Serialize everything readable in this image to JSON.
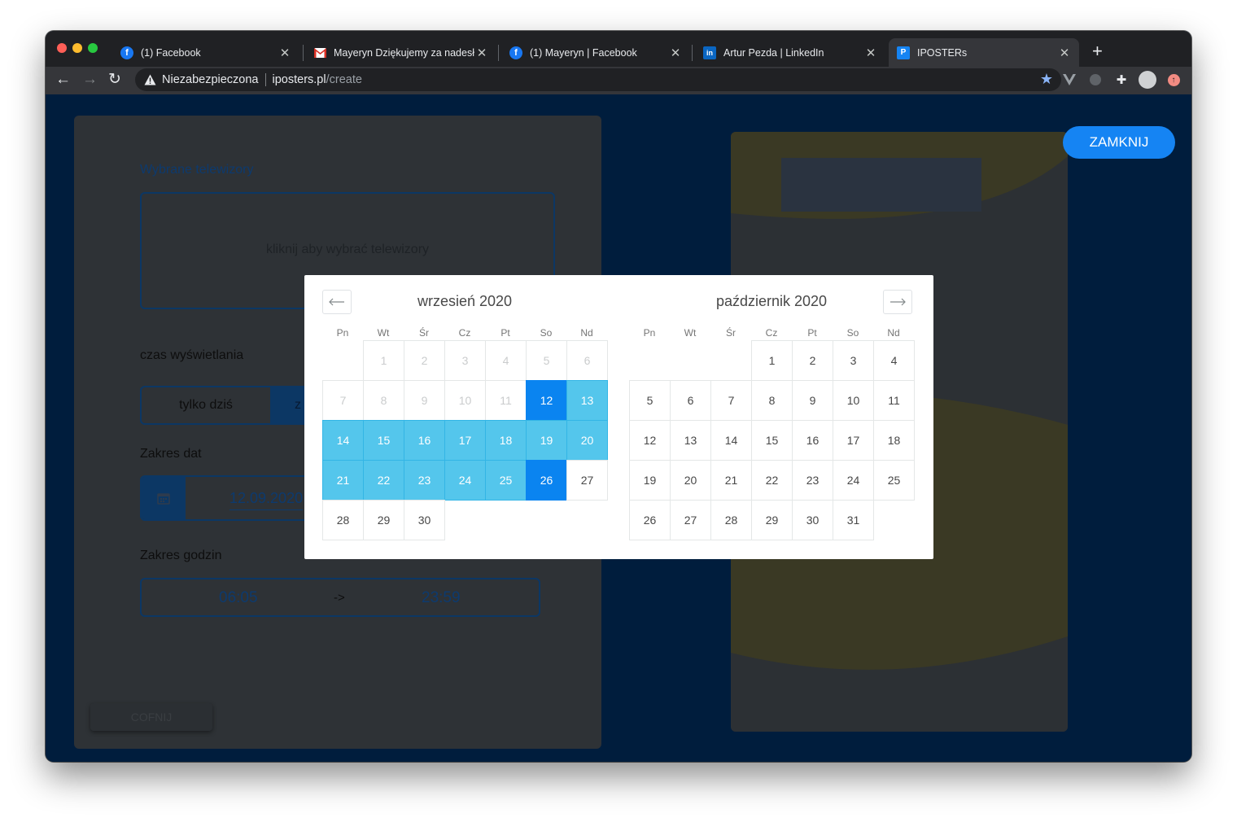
{
  "browser": {
    "tabs": [
      {
        "title": "(1) Facebook",
        "icon": "facebook-icon",
        "active": false
      },
      {
        "title": "Mayeryn Dziękujemy za nadesł",
        "icon": "gmail-icon",
        "active": false
      },
      {
        "title": "(1) Mayeryn | Facebook",
        "icon": "facebook-icon",
        "active": false
      },
      {
        "title": "Artur Pezda | LinkedIn",
        "icon": "linkedin-icon",
        "active": false
      },
      {
        "title": "IPOSTERs",
        "icon": "iposters-icon",
        "active": true
      }
    ],
    "security_label": "Niezabezpieczona",
    "url_host": "iposters.pl",
    "url_path": "/create",
    "colors": {
      "accent": "#1584f3",
      "page_bg": "#001d3d",
      "range": "#54c6ec",
      "selected": "#0a84f0"
    }
  },
  "form": {
    "tv_label": "Wybrane telewizory",
    "tv_placeholder": "kliknij aby wybrać telewizory",
    "display_time_label": "czas wyświetlania",
    "option_today": "tylko dziś",
    "option_other": "z",
    "date_range_label": "Zakres dat",
    "date_start": "12.09.2020",
    "time_range_label": "Zakres godzin",
    "time_start": "06:05",
    "time_arrow": "->",
    "time_end": "23:59",
    "back_button": "COFNIJ"
  },
  "close_button": "ZAMKNIJ",
  "calendar": {
    "weekdays": [
      "Pn",
      "Wt",
      "Śr",
      "Cz",
      "Pt",
      "So",
      "Nd"
    ],
    "months": [
      {
        "title": "wrzesień 2020",
        "offset": 1,
        "days": 30,
        "blocked_until": 11,
        "selected_start": 12,
        "selected_end": 26
      },
      {
        "title": "październik 2020",
        "offset": 3,
        "days": 31,
        "blocked_until": 0,
        "selected_start": null,
        "selected_end": null
      }
    ]
  }
}
